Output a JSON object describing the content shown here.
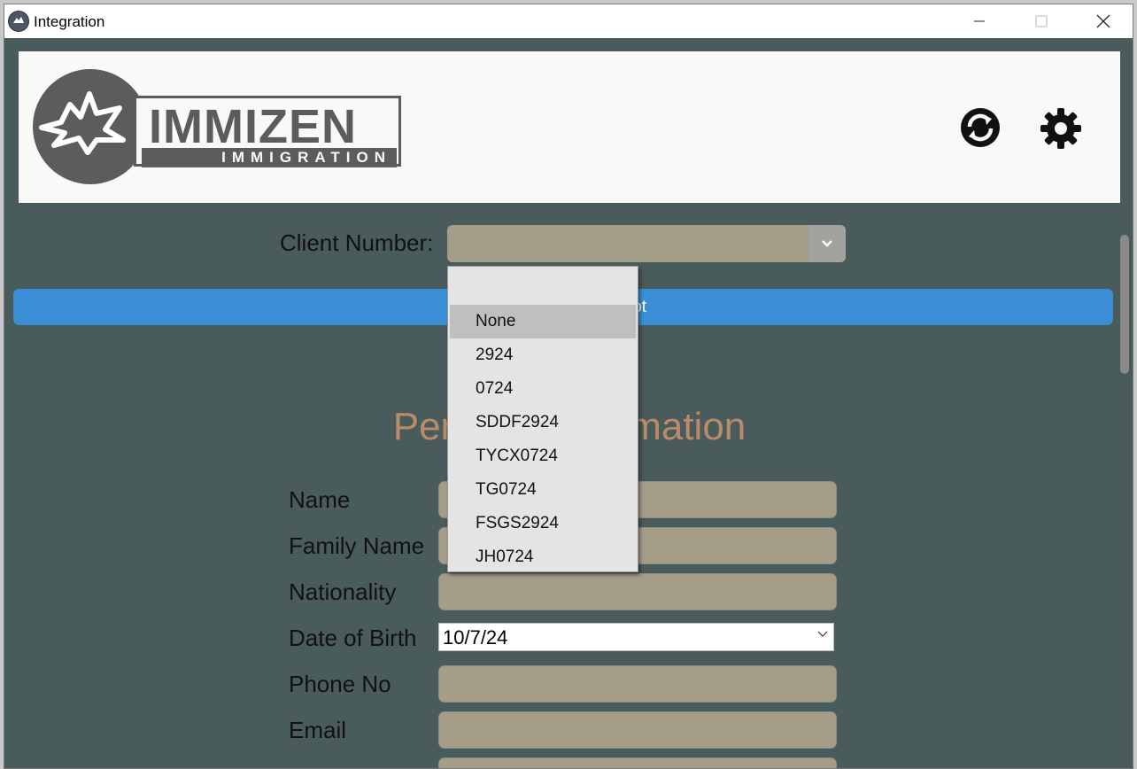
{
  "window": {
    "title": "Integration",
    "controls": {
      "minimize": "—",
      "maximize": "☐",
      "close": "✕"
    }
  },
  "header": {
    "logo_main": "IMMIZEN",
    "logo_sub": "IMMIGRATION",
    "icons": [
      "sync-icon",
      "settings-gear-icon"
    ]
  },
  "client": {
    "label": "Client Number:",
    "selected_value": "",
    "dropdown_options": [
      "",
      "None",
      "2924",
      "0724",
      "SDDF2924",
      "TYCX0724",
      "TG0724",
      "FSGS2924",
      "JH0724"
    ],
    "highlighted_option": "None"
  },
  "script_button": {
    "label": "ipt"
  },
  "section": {
    "title": "Pers    mation"
  },
  "form": {
    "fields": [
      {
        "label": "Name",
        "value": ""
      },
      {
        "label": "Family Name",
        "value": ""
      },
      {
        "label": "Nationality",
        "value": ""
      },
      {
        "label": "Date of Birth",
        "value": "10/7/24"
      },
      {
        "label": "Phone No",
        "value": ""
      },
      {
        "label": "Email",
        "value": ""
      }
    ]
  },
  "colors": {
    "window_bg": "#4a5b5c",
    "header_bg": "#faf9f7",
    "field_bg": "#a59d88",
    "accent_blue": "#3a8fd6",
    "section_title": "#b88c6a"
  }
}
